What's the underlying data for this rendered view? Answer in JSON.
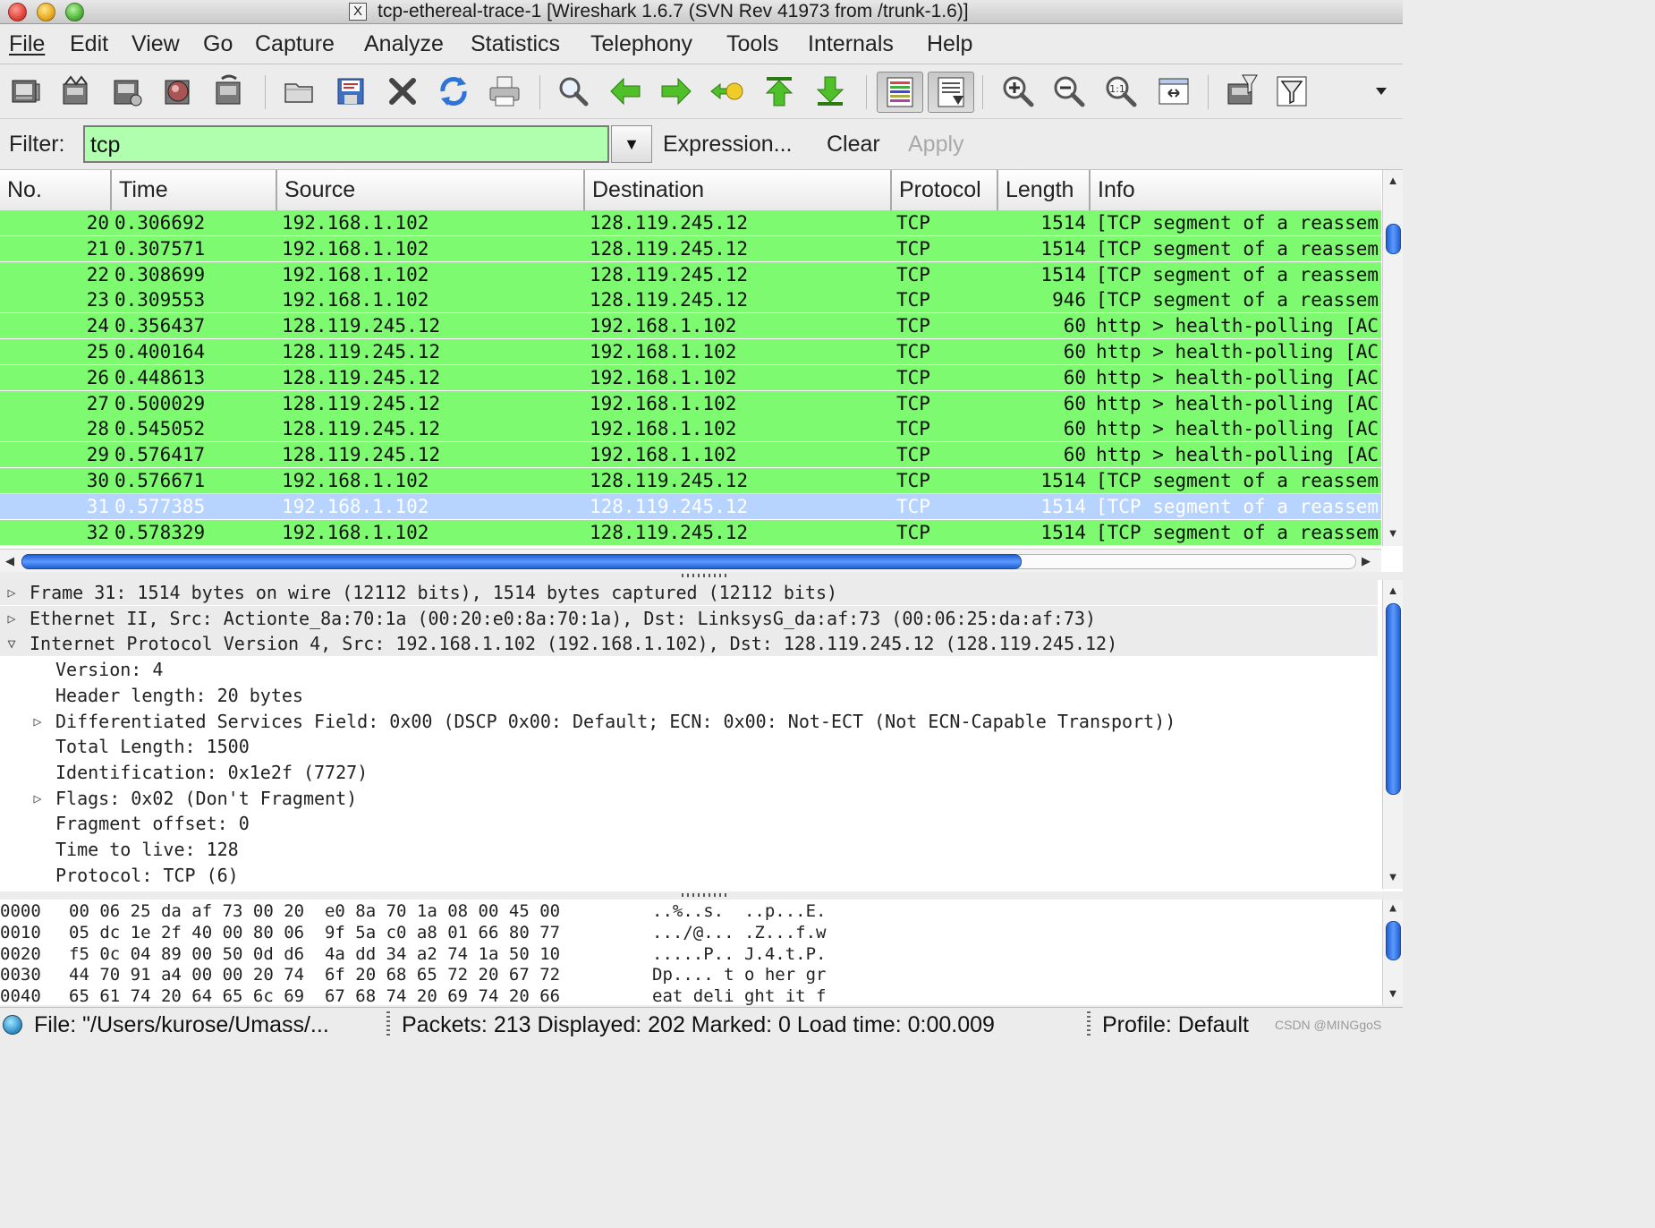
{
  "window": {
    "title": "tcp-ethereal-trace-1   [Wireshark 1.6.7  (SVN Rev 41973 from /trunk-1.6)]",
    "x11_glyph": "X"
  },
  "menu": [
    "File",
    "Edit",
    "View",
    "Go",
    "Capture",
    "Analyze",
    "Statistics",
    "Telephony",
    "Tools",
    "Internals",
    "Help"
  ],
  "toolbar": {
    "icons": [
      "interface-list-icon",
      "capture-options-icon",
      "start-capture-icon",
      "stop-capture-icon",
      "restart-capture-icon",
      "open-file-icon",
      "save-file-icon",
      "close-file-icon",
      "reload-icon",
      "print-icon",
      "find-packet-icon",
      "go-back-icon",
      "go-forward-icon",
      "go-to-packet-icon",
      "first-packet-icon",
      "last-packet-icon",
      "colorize-icon",
      "auto-scroll-icon",
      "zoom-in-icon",
      "zoom-out-icon",
      "normal-size-icon",
      "resize-columns-icon",
      "capture-filters-icon",
      "display-filters-icon",
      "toolbar-overflow-icon"
    ]
  },
  "filter": {
    "label": "Filter:",
    "value": "tcp",
    "expression_label": "Expression...",
    "clear_label": "Clear",
    "apply_label": "Apply",
    "valid_color": "#afffaf"
  },
  "packet_list": {
    "columns": [
      "No.",
      "Time",
      "Source",
      "Destination",
      "Protocol",
      "Length",
      "Info"
    ],
    "row_color": "#7dfa6f",
    "selected_color": "#b6d4ff",
    "rows": [
      {
        "no": "20",
        "time": "0.306692",
        "src": "192.168.1.102",
        "dst": "128.119.245.12",
        "proto": "TCP",
        "len": "1514",
        "info": "[TCP segment of a reassem"
      },
      {
        "no": "21",
        "time": "0.307571",
        "src": "192.168.1.102",
        "dst": "128.119.245.12",
        "proto": "TCP",
        "len": "1514",
        "info": "[TCP segment of a reassem"
      },
      {
        "no": "22",
        "time": "0.308699",
        "src": "192.168.1.102",
        "dst": "128.119.245.12",
        "proto": "TCP",
        "len": "1514",
        "info": "[TCP segment of a reassem"
      },
      {
        "no": "23",
        "time": "0.309553",
        "src": "192.168.1.102",
        "dst": "128.119.245.12",
        "proto": "TCP",
        "len": "946",
        "info": "[TCP segment of a reassem"
      },
      {
        "no": "24",
        "time": "0.356437",
        "src": "128.119.245.12",
        "dst": "192.168.1.102",
        "proto": "TCP",
        "len": "60",
        "info": "http > health-polling [AC"
      },
      {
        "no": "25",
        "time": "0.400164",
        "src": "128.119.245.12",
        "dst": "192.168.1.102",
        "proto": "TCP",
        "len": "60",
        "info": "http > health-polling [AC"
      },
      {
        "no": "26",
        "time": "0.448613",
        "src": "128.119.245.12",
        "dst": "192.168.1.102",
        "proto": "TCP",
        "len": "60",
        "info": "http > health-polling [AC"
      },
      {
        "no": "27",
        "time": "0.500029",
        "src": "128.119.245.12",
        "dst": "192.168.1.102",
        "proto": "TCP",
        "len": "60",
        "info": "http > health-polling [AC"
      },
      {
        "no": "28",
        "time": "0.545052",
        "src": "128.119.245.12",
        "dst": "192.168.1.102",
        "proto": "TCP",
        "len": "60",
        "info": "http > health-polling [AC"
      },
      {
        "no": "29",
        "time": "0.576417",
        "src": "128.119.245.12",
        "dst": "192.168.1.102",
        "proto": "TCP",
        "len": "60",
        "info": "http > health-polling [AC"
      },
      {
        "no": "30",
        "time": "0.576671",
        "src": "192.168.1.102",
        "dst": "128.119.245.12",
        "proto": "TCP",
        "len": "1514",
        "info": "[TCP segment of a reassem"
      },
      {
        "no": "31",
        "time": "0.577385",
        "src": "192.168.1.102",
        "dst": "128.119.245.12",
        "proto": "TCP",
        "len": "1514",
        "info": "[TCP segment of a reassem",
        "selected": true
      },
      {
        "no": "32",
        "time": "0.578329",
        "src": "192.168.1.102",
        "dst": "128.119.245.12",
        "proto": "TCP",
        "len": "1514",
        "info": "[TCP segment of a reassem"
      }
    ]
  },
  "details": {
    "lines": [
      {
        "text": "Frame 31: 1514 bytes on wire (12112 bits), 1514 bytes captured (12112 bits)",
        "level": 0,
        "expander": "collapsed",
        "top": true
      },
      {
        "text": "Ethernet II, Src: Actionte_8a:70:1a (00:20:e0:8a:70:1a), Dst: LinksysG_da:af:73 (00:06:25:da:af:73)",
        "level": 0,
        "expander": "collapsed",
        "top": true
      },
      {
        "text": "Internet Protocol Version 4, Src: 192.168.1.102 (192.168.1.102), Dst: 128.119.245.12 (128.119.245.12)",
        "level": 0,
        "expander": "expanded",
        "top": true
      },
      {
        "text": "Version: 4",
        "level": 1,
        "expander": "none"
      },
      {
        "text": "Header length: 20 bytes",
        "level": 1,
        "expander": "none"
      },
      {
        "text": "Differentiated Services Field: 0x00 (DSCP 0x00: Default; ECN: 0x00: Not-ECT (Not ECN-Capable Transport))",
        "level": 1,
        "expander": "collapsed"
      },
      {
        "text": "Total Length: 1500",
        "level": 1,
        "expander": "none"
      },
      {
        "text": "Identification: 0x1e2f (7727)",
        "level": 1,
        "expander": "none"
      },
      {
        "text": "Flags: 0x02 (Don't Fragment)",
        "level": 1,
        "expander": "collapsed"
      },
      {
        "text": "Fragment offset: 0",
        "level": 1,
        "expander": "none"
      },
      {
        "text": "Time to live: 128",
        "level": 1,
        "expander": "none"
      },
      {
        "text": "Protocol: TCP (6)",
        "level": 1,
        "expander": "none"
      }
    ]
  },
  "bytes": {
    "rows": [
      {
        "offset": "0000",
        "hex": "00 06 25 da af 73 00 20  e0 8a 70 1a 08 00 45 00",
        "ascii": "..%..s.  ..p...E."
      },
      {
        "offset": "0010",
        "hex": "05 dc 1e 2f 40 00 80 06  9f 5a c0 a8 01 66 80 77",
        "ascii": ".../@... .Z...f.w"
      },
      {
        "offset": "0020",
        "hex": "f5 0c 04 89 00 50 0d d6  4a dd 34 a2 74 1a 50 10",
        "ascii": ".....P.. J.4.t.P."
      },
      {
        "offset": "0030",
        "hex": "44 70 91 a4 00 00 20 74  6f 20 68 65 72 20 67 72",
        "ascii": "Dp.... t o her gr"
      },
      {
        "offset": "0040",
        "hex": "65 61 74 20 64 65 6c 69  67 68 74 20 69 74 20 66",
        "ascii": "eat deli ght it f"
      }
    ]
  },
  "status": {
    "file": "File: \"/Users/kurose/Umass/...",
    "packets": "Packets: 213 Displayed: 202 Marked: 0 Load time: 0:00.009",
    "profile": "Profile: Default",
    "watermark": "CSDN @MINGgoS"
  }
}
